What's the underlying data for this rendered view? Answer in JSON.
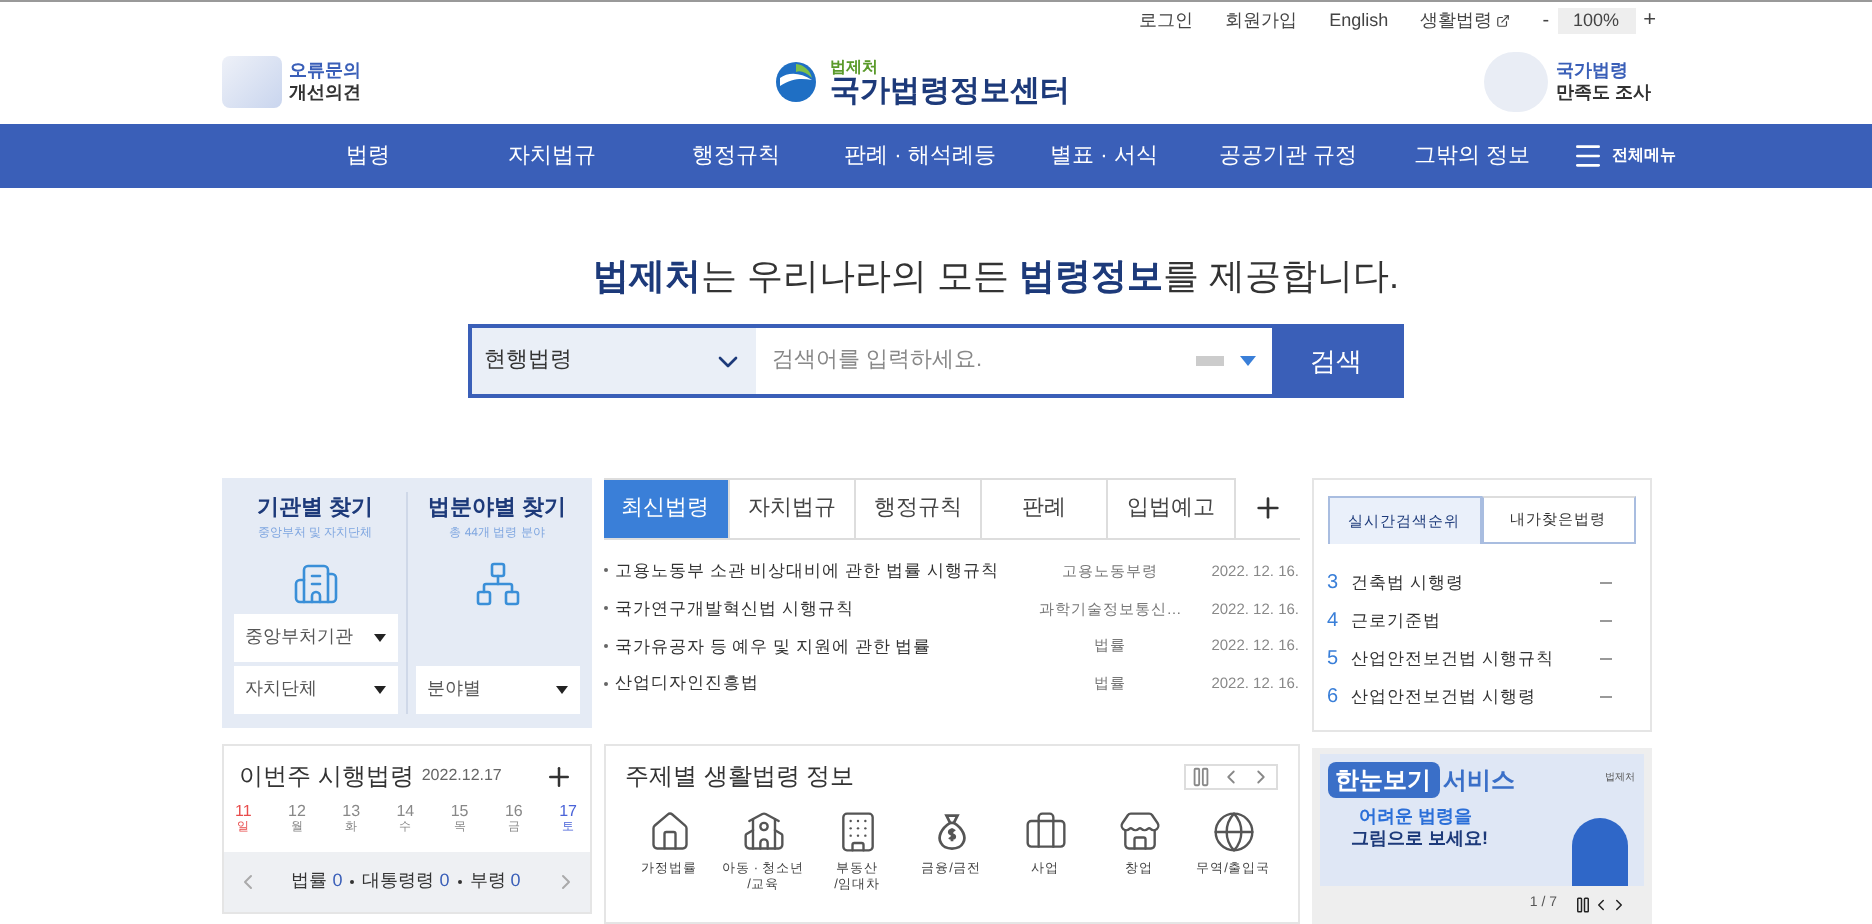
{
  "top_links": [
    {
      "label": "로그인",
      "external": false
    },
    {
      "label": "회원가입",
      "external": false
    },
    {
      "label": "English",
      "external": false
    },
    {
      "label": "생활법령",
      "external": true
    }
  ],
  "zoom": {
    "minus": "-",
    "value": "100%",
    "plus": "+"
  },
  "header": {
    "left_lines": [
      "오류문의",
      "개선의견"
    ],
    "org": "법제처",
    "site": "국가법령정보센터",
    "right_lines": [
      "국가법령",
      "만족도 조사"
    ]
  },
  "nav": {
    "items": [
      "법령",
      "자치법규",
      "행정규칙",
      "판례 · 해석례등",
      "별표 · 서식",
      "공공기관 규정",
      "그밖의 정보"
    ],
    "all_menu": "전체메뉴"
  },
  "headline": "**법제처**는 우리나라의 모든 **법령정보**를 제공합니다.",
  "search": {
    "scope": "현행법령",
    "placeholder": "검색어를 입력하세요.",
    "button": "검색"
  },
  "finder": [
    {
      "title": "기관별 찾기",
      "subtitle": "중앙부처 및 자치단체",
      "kind": "building",
      "selects": [
        "중앙부처기관",
        "자치단체"
      ]
    },
    {
      "title": "법분야별 찾기",
      "subtitle": "총 44개 법령 분야",
      "kind": "tree",
      "selects": [
        "분야별"
      ]
    }
  ],
  "weekly": {
    "title": "이번주 시행법령",
    "date": "2022.12.17",
    "days": [
      {
        "num": "11",
        "dow": "일",
        "color": "#e84c4c"
      },
      {
        "num": "12",
        "dow": "월",
        "color": "#888888"
      },
      {
        "num": "13",
        "dow": "화",
        "color": "#888888"
      },
      {
        "num": "14",
        "dow": "수",
        "color": "#888888"
      },
      {
        "num": "15",
        "dow": "목",
        "color": "#888888"
      },
      {
        "num": "16",
        "dow": "금",
        "color": "#888888"
      },
      {
        "num": "17",
        "dow": "토",
        "color": "#4a63d8"
      }
    ],
    "counts": [
      {
        "label": "법률",
        "count": "0"
      },
      {
        "label": "대통령령",
        "count": "0"
      },
      {
        "label": "부령",
        "count": "0"
      }
    ]
  },
  "news_tabs": [
    {
      "label": "최신법령",
      "selected": true
    },
    {
      "label": "자치법규",
      "selected": false
    },
    {
      "label": "행정규칙",
      "selected": false
    },
    {
      "label": "판례",
      "selected": false
    },
    {
      "label": "입법예고",
      "selected": false
    }
  ],
  "news": [
    {
      "title": "고용노동부 소관 비상대비에 관한 법률 시행규칙",
      "type": "고용노동부령",
      "date": "2022. 12. 16."
    },
    {
      "title": "국가연구개발혁신법 시행규칙",
      "type": "과학기술정보통신…",
      "date": "2022. 12. 16."
    },
    {
      "title": "국가유공자 등 예우 및 지원에 관한 법률",
      "type": "법률",
      "date": "2022. 12. 16."
    },
    {
      "title": "산업디자인진흥법",
      "type": "법률",
      "date": "2022. 12. 16."
    }
  ],
  "topics": {
    "title": "주제별 생활법령 정보",
    "items": [
      {
        "kind": "home",
        "lines": [
          "가정법률"
        ]
      },
      {
        "kind": "school",
        "lines": [
          "아동 · 청소년",
          "/교육"
        ]
      },
      {
        "kind": "building",
        "lines": [
          "부동산",
          "/임대차"
        ]
      },
      {
        "kind": "money",
        "lines": [
          "금융/금전"
        ]
      },
      {
        "kind": "briefcase",
        "lines": [
          "사업"
        ]
      },
      {
        "kind": "store",
        "lines": [
          "창업"
        ]
      },
      {
        "kind": "globe",
        "lines": [
          "무역/출입국"
        ]
      }
    ]
  },
  "ranking_tabs": [
    {
      "label": "실시간검색순위",
      "selected": true
    },
    {
      "label": "내가찾은법령",
      "selected": false
    }
  ],
  "ranking": [
    {
      "rank": "3",
      "name": "건축법 시행령"
    },
    {
      "rank": "4",
      "name": "근로기준법"
    },
    {
      "rank": "5",
      "name": "산업안전보건법 시행규칙"
    },
    {
      "rank": "6",
      "name": "산업안전보건법 시행령"
    }
  ],
  "banner": {
    "title_a": "한눈보기",
    "title_b": "서비스",
    "org": "법제처",
    "line1": "어려운 **법령**을",
    "line2": "그림으로 보세요!",
    "page": "1 / 7"
  }
}
